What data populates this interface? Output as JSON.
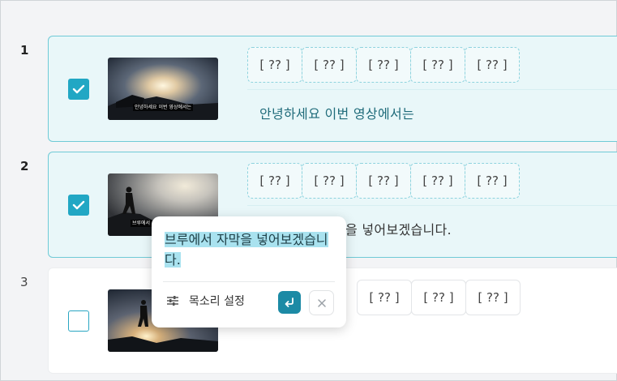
{
  "rows": [
    {
      "number": "1",
      "checked": true,
      "tokens": [
        "[ ?? ]",
        "[ ?? ]",
        "[ ?? ]",
        "[ ?? ]",
        "[ ?? ]"
      ],
      "subtitle": "안녕하세요  이번  영상에서는",
      "thumb_caption": "안녕하세요 이번 영상에서는"
    },
    {
      "number": "2",
      "checked": true,
      "tokens": [
        "[ ?? ]",
        "[ ?? ]",
        "[ ?? ]",
        "[ ?? ]",
        "[ ?? ]"
      ],
      "subtitle": "을  넣어보겠습니다.",
      "thumb_caption": "브루에서"
    },
    {
      "number": "3",
      "checked": false,
      "tokens": [
        "[ ?? ]",
        "[ ?? ]",
        "[ ?? ]"
      ],
      "subtitle": ""
    }
  ],
  "popup": {
    "edit_text": "브루에서 자막을 넣어보겠습니다.",
    "voice_settings_label": "목소리 설정"
  },
  "colors": {
    "accent": "#21a7c4",
    "active_card_bg": "#e9f7f9",
    "active_card_border": "#6fcad6",
    "confirm": "#1c8aa5"
  }
}
